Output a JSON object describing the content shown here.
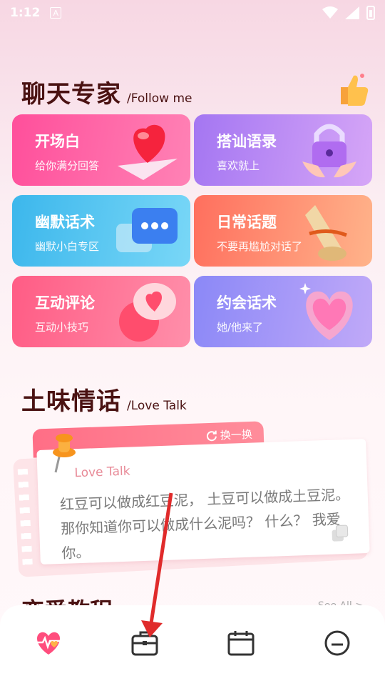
{
  "status": {
    "time": "1:12",
    "a_icon": "A"
  },
  "section1": {
    "title": "聊天专家",
    "subtitle": "/Follow me"
  },
  "cards": [
    {
      "title": "开场白",
      "subtitle": "给你满分回答",
      "icon": "heart-paper-plane-icon"
    },
    {
      "title": "搭讪语录",
      "subtitle": "喜欢就上",
      "icon": "padlock-hands-icon"
    },
    {
      "title": "幽默话术",
      "subtitle": "幽默小白专区",
      "icon": "chat-bubble-icon"
    },
    {
      "title": "日常话题",
      "subtitle": "不要再尴尬对话了",
      "icon": "scroll-icon"
    },
    {
      "title": "互动评论",
      "subtitle": "互动小技巧",
      "icon": "heart-bubble-icon"
    },
    {
      "title": "约会话术",
      "subtitle": "她/他来了",
      "icon": "heart-icon"
    }
  ],
  "section2": {
    "title": "土味情话",
    "subtitle": "/Love Talk"
  },
  "love_talk": {
    "swap_label": "换一换",
    "label": "Love Talk",
    "text": "红豆可以做成红豆泥， 土豆可以做成土豆泥。 那你知道你可以做成什么泥吗？ 什么？ 我爱你。"
  },
  "section3": {
    "title": "恋爱教程",
    "more": "See All >"
  },
  "nav": [
    {
      "name": "nav-home",
      "icon": "heart-pulse-icon"
    },
    {
      "name": "nav-toolbox",
      "icon": "briefcase-icon"
    },
    {
      "name": "nav-calendar",
      "icon": "calendar-icon"
    },
    {
      "name": "nav-profile",
      "icon": "face-icon"
    }
  ],
  "colors": {
    "title": "#4a1212",
    "card1": "#ff4f9b",
    "card2": "#a476f2",
    "card3": "#3cb7ec",
    "card4": "#ff6f5e",
    "card5": "#ff5c85",
    "card6": "#8b88f7",
    "arrow": "#e02b2b"
  }
}
